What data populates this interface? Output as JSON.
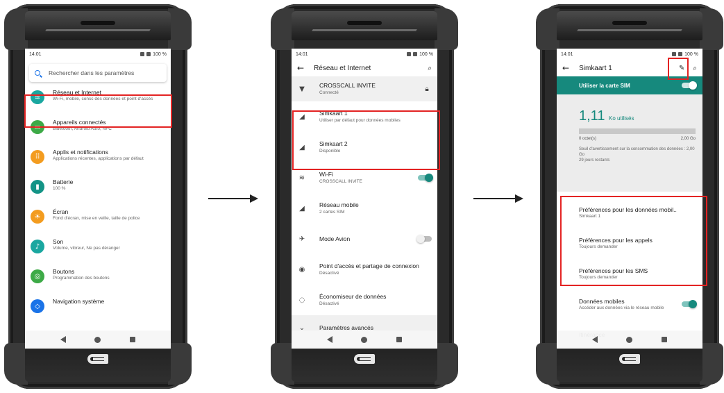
{
  "colors": {
    "accent": "#16897d",
    "highlight": "#e32323",
    "search": "#1a73e8"
  },
  "screen1": {
    "time": "14:01",
    "battery": "100 %",
    "search_placeholder": "Rechercher dans les paramètres",
    "items": [
      {
        "title": "Réseau et Internet",
        "subtitle": "Wi-Fi, mobile, consc des données et point d'accès",
        "icon": "wifi-icon",
        "color": "#1aa7a0"
      },
      {
        "title": "Appareils connectés",
        "subtitle": "Bluetooth, Android Auto, NFC",
        "icon": "devices-icon",
        "color": "#3daa47"
      },
      {
        "title": "Applis et notifications",
        "subtitle": "Applications récentes, applications par défaut",
        "icon": "apps-icon",
        "color": "#f39c1f"
      },
      {
        "title": "Batterie",
        "subtitle": "100 %",
        "icon": "battery-icon",
        "color": "#139486"
      },
      {
        "title": "Écran",
        "subtitle": "Fond d'écran, mise en veille, taille de police",
        "icon": "brightness-icon",
        "color": "#f39c1f"
      },
      {
        "title": "Son",
        "subtitle": "Volume, vibreur, Ne pas déranger",
        "icon": "volume-icon",
        "color": "#1aa7a0"
      },
      {
        "title": "Boutons",
        "subtitle": "Programmation des boutons",
        "icon": "buttons-icon",
        "color": "#3daa47"
      },
      {
        "title": "Navigation système",
        "subtitle": "",
        "icon": "navigation-icon",
        "color": "#1a73e8"
      }
    ]
  },
  "screen2": {
    "time": "14:01",
    "battery": "100 %",
    "title": "Réseau et Internet",
    "items": [
      {
        "title": "CROSSCALL INVITE",
        "subtitle": "Connecté",
        "icon": "wifi-lock-icon"
      },
      {
        "title": "Simkaart 1",
        "subtitle": "Utiliser par défaut pour données mobiles",
        "icon": "signal-icon"
      },
      {
        "title": "Simkaart 2",
        "subtitle": "Disponible",
        "icon": "signal-icon"
      },
      {
        "title": "Wi-Fi",
        "subtitle": "CROSSCALL INVITE",
        "icon": "wifi-icon",
        "toggle": "on"
      },
      {
        "title": "Réseau mobile",
        "subtitle": "2 cartes SIM",
        "icon": "signal-icon"
      },
      {
        "title": "Mode Avion",
        "subtitle": "",
        "icon": "airplane-icon",
        "toggle": "off"
      },
      {
        "title": "Point d'accès et partage de connexion",
        "subtitle": "Désactivé",
        "icon": "hotspot-icon"
      },
      {
        "title": "Économiseur de données",
        "subtitle": "Désactivé",
        "icon": "data-saver-icon"
      },
      {
        "title": "Paramètres avancés",
        "subtitle": "",
        "icon": "chevron-icon"
      }
    ]
  },
  "screen3": {
    "time": "14:01",
    "battery": "100 %",
    "title": "Simkaart 1",
    "use_sim": "Utiliser la carte SIM",
    "usage_value": "1,11",
    "usage_unit": "Ko utilisés",
    "usage_fraction": 0.0,
    "scale_min": "0 octet(s)",
    "scale_max": "2,00 Go",
    "warning": "Seuil d'avertissement sur la consommation des données : 2,00 Go",
    "days_left": "29 jours restants",
    "prefs": [
      {
        "title": "Préférences pour les données mobil..",
        "subtitle": "Simkaart 1"
      },
      {
        "title": "Préférences pour les appels",
        "subtitle": "Toujours demander"
      },
      {
        "title": "Préférences pour les SMS",
        "subtitle": "Toujours demander"
      },
      {
        "title": "Données mobiles",
        "subtitle": "Accéder aux données via le réseau mobile",
        "toggle": "on"
      },
      {
        "title": "Itinérance",
        "subtitle": ""
      }
    ]
  }
}
